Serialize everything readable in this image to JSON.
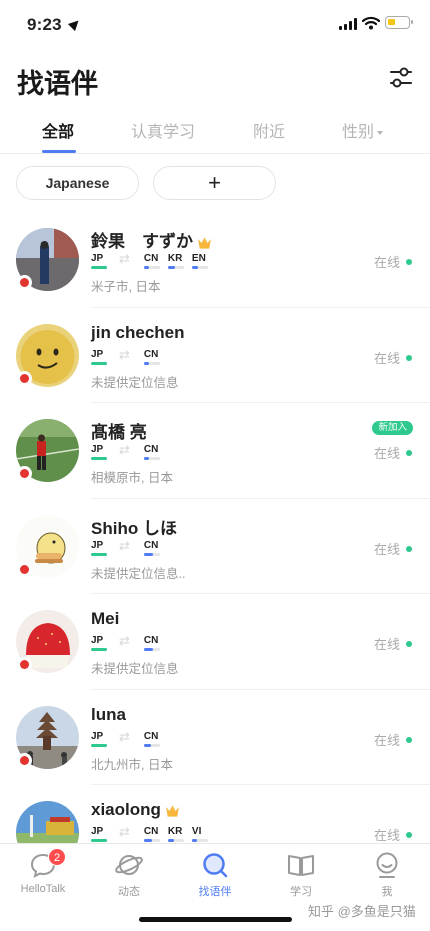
{
  "status_bar": {
    "time": "9:23"
  },
  "header": {
    "title": "找语伴"
  },
  "tabs": [
    {
      "label": "全部",
      "active": true
    },
    {
      "label": "认真学习",
      "active": false
    },
    {
      "label": "附近",
      "active": false
    },
    {
      "label": "性别",
      "active": false
    }
  ],
  "filters": {
    "language": "Japanese",
    "add": "+"
  },
  "users": [
    {
      "name": "鈴果　すずか",
      "vip": true,
      "native": [
        "JP"
      ],
      "learning": [
        {
          "code": "CN",
          "level": 0.3
        },
        {
          "code": "KR",
          "level": 0.45
        },
        {
          "code": "EN",
          "level": 0.4
        }
      ],
      "location": "米子市, 日本",
      "status": "在线",
      "new": ""
    },
    {
      "name": "jin chechen",
      "vip": false,
      "native": [
        "JP"
      ],
      "learning": [
        {
          "code": "CN",
          "level": 0.3
        }
      ],
      "location": "未提供定位信息",
      "status": "在线",
      "new": ""
    },
    {
      "name": "髙橋 亮",
      "vip": false,
      "native": [
        "JP"
      ],
      "learning": [
        {
          "code": "CN",
          "level": 0.3
        }
      ],
      "location": "相模原市, 日本",
      "status": "在线",
      "new": "新加入"
    },
    {
      "name": "Shiho しほ",
      "vip": false,
      "native": [
        "JP"
      ],
      "learning": [
        {
          "code": "CN",
          "level": 0.55
        }
      ],
      "location": "未提供定位信息..",
      "status": "在线",
      "new": ""
    },
    {
      "name": "Mei",
      "vip": false,
      "native": [
        "JP"
      ],
      "learning": [
        {
          "code": "CN",
          "level": 0.55
        }
      ],
      "location": "未提供定位信息",
      "status": "在线",
      "new": ""
    },
    {
      "name": "luna",
      "vip": false,
      "native": [
        "JP"
      ],
      "learning": [
        {
          "code": "CN",
          "level": 0.45
        }
      ],
      "location": "北九州市, 日本",
      "status": "在线",
      "new": ""
    },
    {
      "name": "xiaolong",
      "vip": true,
      "native": [
        "JP"
      ],
      "learning": [
        {
          "code": "CN",
          "level": 0.5
        },
        {
          "code": "KR",
          "level": 0.35
        },
        {
          "code": "VI",
          "level": 0.3
        }
      ],
      "location": "",
      "status": "在线",
      "new": ""
    }
  ],
  "bottom_nav": [
    {
      "label": "HelloTalk",
      "icon": "chat-bubble-icon",
      "badge": "2",
      "active": false
    },
    {
      "label": "动态",
      "icon": "planet-icon",
      "badge": "",
      "active": false
    },
    {
      "label": "找语伴",
      "icon": "search-icon",
      "badge": "",
      "active": true
    },
    {
      "label": "学习",
      "icon": "book-icon",
      "badge": "",
      "active": false
    },
    {
      "label": "我",
      "icon": "profile-face-icon",
      "badge": "",
      "active": false
    }
  ],
  "watermark": "知乎 @多鱼是只猫",
  "colors": {
    "accent": "#4f7cf2",
    "online": "#2dc98d",
    "native_bar": "#2dc98d",
    "learning_bar": "#4f7cf2",
    "presence_dot": "#e3342f",
    "badge": "#ff4d4f"
  }
}
